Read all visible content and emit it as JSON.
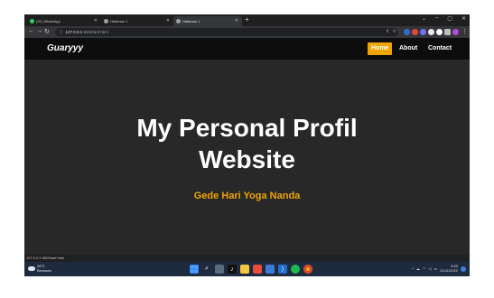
{
  "browser": {
    "tabs": [
      {
        "title": "(31) WhatsApp",
        "active": false,
        "favicon_color": "#25d366"
      },
      {
        "title": "Halaman 1",
        "active": false,
        "favicon_color": "#9aa0a6"
      },
      {
        "title": "Halaman 1",
        "active": true,
        "favicon_color": "#9aa0a6"
      }
    ],
    "new_tab_glyph": "+",
    "address": {
      "host": "127.0.0.1",
      "path": ":5500/anf.html"
    },
    "status_url": "127.0.0.1:5500/anf.html"
  },
  "site": {
    "brand": "Guaryyy",
    "nav": [
      "Home",
      "About",
      "Contact"
    ],
    "accent_color": "#f0a400",
    "hero_title_line1": "My Personal Profil",
    "hero_title_line2": "Website",
    "hero_subtitle": "Gede Hari Yoga Nanda"
  },
  "taskbar": {
    "weather_temp": "28°C",
    "weather_desc": "Berawan",
    "time": "9:20",
    "date": "21/11/2022",
    "apps": [
      "windows-icon",
      "search-icon",
      "taskview-icon",
      "tiktok-icon",
      "files-icon",
      "store-icon",
      "notes-icon",
      "vscode-icon",
      "spotify-icon",
      "chrome-icon"
    ]
  }
}
